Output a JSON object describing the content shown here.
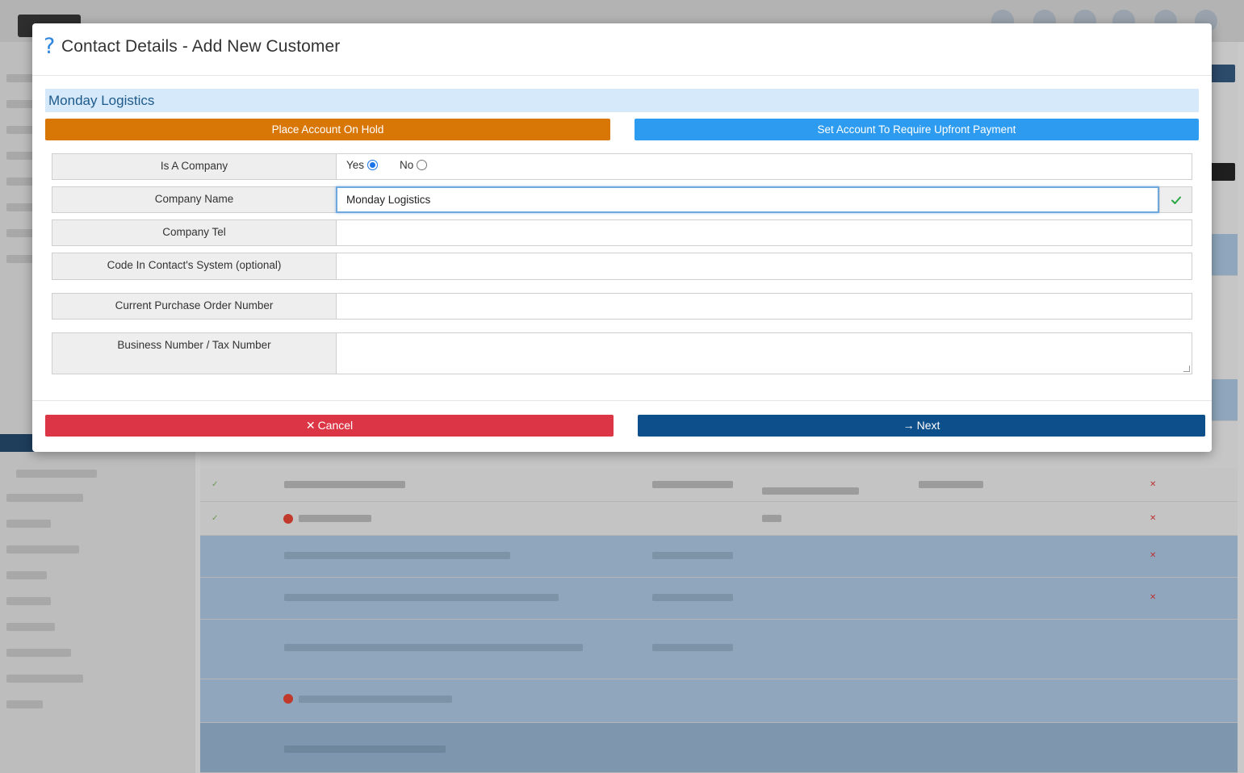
{
  "modal": {
    "help_icon": "?",
    "title": "Contact Details - Add New Customer",
    "company_banner": "Monday Logistics",
    "hold_button": "Place Account On Hold",
    "upfront_button": "Set Account To Require Upfront Payment",
    "colors": {
      "hold": "#d97706",
      "upfront": "#2d9cf0",
      "cancel": "#dc3545",
      "next": "#0d4f8b",
      "banner": "#d6e9fb",
      "valid_check": "#28a745"
    },
    "fields": {
      "is_company": {
        "label": "Is A Company",
        "yes_label": "Yes",
        "no_label": "No",
        "selected": "Yes"
      },
      "company_name": {
        "label": "Company Name",
        "value": "Monday Logistics",
        "status_icon": "check-icon"
      },
      "company_tel": {
        "label": "Company Tel",
        "value": ""
      },
      "code_in_system": {
        "label": "Code In Contact's System (optional)",
        "value": ""
      },
      "purchase_order": {
        "label": "Current Purchase Order Number",
        "value": ""
      },
      "tax_number": {
        "label": "Business Number / Tax Number",
        "value": ""
      }
    },
    "footer": {
      "cancel_icon": "✕",
      "cancel_label": "Cancel",
      "next_icon": "→",
      "next_label": "Next"
    }
  }
}
